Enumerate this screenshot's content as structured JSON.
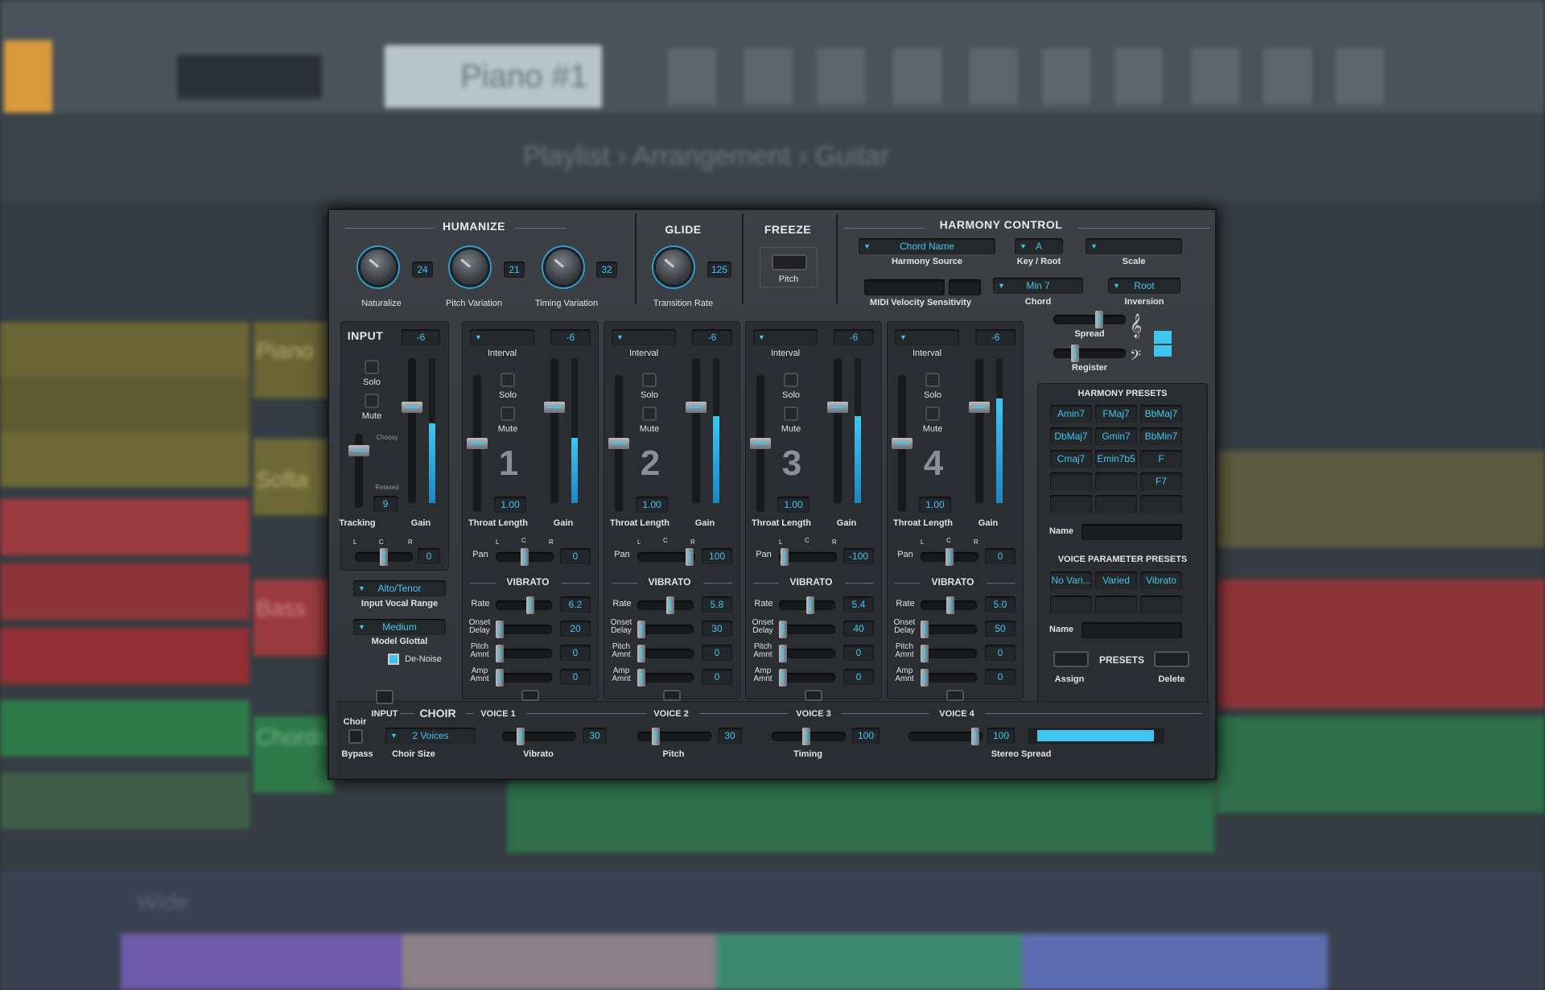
{
  "background": {
    "window_title": "Piano #1",
    "mode": "Line",
    "breadcrumb": [
      "Playlist",
      "Arrangement",
      "Guitar"
    ],
    "tracks": [
      "Piano",
      "Softa",
      "Bass",
      "Chords"
    ],
    "bottom_label": "Wide"
  },
  "humanize": {
    "header": "HUMANIZE",
    "knobs": [
      {
        "label": "Naturalize",
        "value": "24"
      },
      {
        "label": "Pitch Variation",
        "value": "21"
      },
      {
        "label": "Timing Variation",
        "value": "32"
      }
    ]
  },
  "glide": {
    "header": "GLIDE",
    "label": "Transition Rate",
    "value": "125"
  },
  "freeze": {
    "header": "FREEZE",
    "label": "Pitch"
  },
  "harmony_control": {
    "header": "HARMONY CONTROL",
    "harmony_source": {
      "value": "Chord Name",
      "label": "Harmony Source"
    },
    "key_root": {
      "value": "A",
      "label": "Key / Root"
    },
    "scale": {
      "value": "",
      "label": "Scale"
    },
    "midi_velocity": {
      "label": "MIDI Velocity Sensitivity"
    },
    "chord": {
      "value": "Min 7",
      "label": "Chord"
    },
    "inversion": {
      "value": "Root",
      "label": "Inversion"
    },
    "spread_label": "Spread",
    "register_label": "Register"
  },
  "input": {
    "header": "INPUT",
    "gain_value": "-6",
    "solo": "Solo",
    "mute": "Mute",
    "choosy": "Choosy",
    "relaxed": "Relaxed",
    "tracking_value": "9",
    "tracking_label": "Tracking",
    "gain_label": "Gain",
    "pan_L": "L",
    "pan_C": "C",
    "pan_R": "R",
    "pan_value": "0",
    "vocal_range": {
      "value": "Alto/Tenor",
      "label": "Input Vocal Range"
    },
    "model_glottal": {
      "value": "Medium",
      "label": "Model Glottal"
    },
    "denoise": "De-Noise",
    "gain_level": 0.55
  },
  "voices": [
    {
      "num": "1",
      "gain": "-6",
      "throat": "1.00",
      "pan": "0",
      "rate": "6.2",
      "onset": "20",
      "pitch_amnt": "0",
      "amp_amnt": "0",
      "level": 0.45
    },
    {
      "num": "2",
      "gain": "-6",
      "throat": "1.00",
      "pan": "100",
      "rate": "5.8",
      "onset": "30",
      "pitch_amnt": "0",
      "amp_amnt": "0",
      "level": 0.6
    },
    {
      "num": "3",
      "gain": "-6",
      "throat": "1.00",
      "pan": "-100",
      "rate": "5.4",
      "onset": "40",
      "pitch_amnt": "0",
      "amp_amnt": "0",
      "level": 0.6
    },
    {
      "num": "4",
      "gain": "-6",
      "throat": "1.00",
      "pan": "0",
      "rate": "5.0",
      "onset": "50",
      "pitch_amnt": "0",
      "amp_amnt": "0",
      "level": 0.72
    }
  ],
  "voice_labels": {
    "interval": "Interval",
    "solo": "Solo",
    "mute": "Mute",
    "throat": "Throat Length",
    "gain": "Gain",
    "pan": "Pan",
    "vibrato": "VIBRATO",
    "rate": "Rate",
    "onset1": "Onset",
    "onset2": "Delay",
    "pitch1": "Pitch",
    "pitch2": "Amnt",
    "amp1": "Amp",
    "amp2": "Amnt",
    "L": "L",
    "C": "C",
    "R": "R"
  },
  "harmony_presets": {
    "header": "HARMONY PRESETS",
    "items": [
      "Amin7",
      "FMaj7",
      "BbMaj7",
      "DbMaj7",
      "Gmin7",
      "BbMin7",
      "Cmaj7",
      "Emin7b5",
      "F",
      "",
      "",
      "F7",
      "",
      "",
      ""
    ],
    "name_label": "Name"
  },
  "voice_param_presets": {
    "header": "VOICE PARAMETER PRESETS",
    "items": [
      "No Vari...",
      "Varied",
      "Vibrato",
      "",
      "",
      ""
    ],
    "name_label": "Name",
    "presets_label": "PRESETS",
    "assign": "Assign",
    "delete": "Delete"
  },
  "choir": {
    "header": "CHOIR",
    "choir_label": "Choir",
    "input_label": "INPUT",
    "bypass": "Bypass",
    "choir_size": {
      "value": "2 Voices",
      "label": "Choir Size"
    },
    "voice_headers": [
      "VOICE 1",
      "VOICE 2",
      "VOICE 3",
      "VOICE 4"
    ],
    "vibrato": {
      "value": "30",
      "label": "Vibrato"
    },
    "pitch": {
      "value": "30",
      "label": "Pitch"
    },
    "timing": {
      "value": "100",
      "label": "Timing"
    },
    "stereo": {
      "value": "100",
      "label": "Stereo Spread"
    }
  },
  "colors": {
    "accent": "#3fc6f0",
    "panel": "#2f3236"
  }
}
